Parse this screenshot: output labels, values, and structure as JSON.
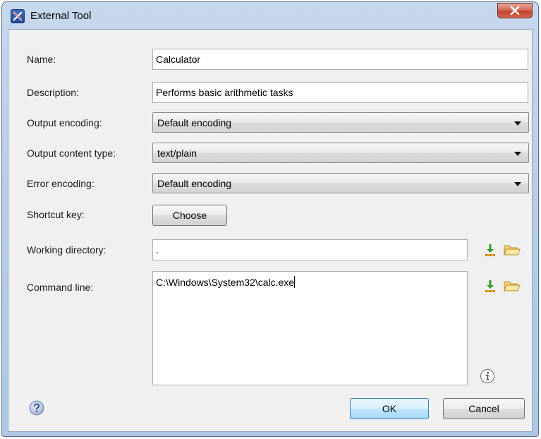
{
  "window": {
    "title": "External Tool",
    "close_label": "X"
  },
  "form": {
    "name_label": "Name:",
    "name_value": "Calculator",
    "description_label": "Description:",
    "description_value": "Performs basic arithmetic tasks",
    "output_encoding_label": "Output encoding:",
    "output_encoding_value": "Default encoding",
    "output_content_type_label": "Output content type:",
    "output_content_type_value": "text/plain",
    "error_encoding_label": "Error encoding:",
    "error_encoding_value": "Default encoding",
    "shortcut_key_label": "Shortcut key:",
    "shortcut_choose_label": "Choose",
    "working_directory_label": "Working directory:",
    "working_directory_value": ".",
    "command_line_label": "Command line:",
    "command_line_value": "C:\\Windows\\System32\\calc.exe"
  },
  "icons": {
    "insert_editor_variable": "insert-variable-icon",
    "browse_folder": "folder-icon",
    "info": "info-icon",
    "help": "help-icon"
  },
  "footer": {
    "ok_label": "OK",
    "cancel_label": "Cancel"
  },
  "colors": {
    "title_bar": "#b9cde6",
    "close_button": "#c2432d",
    "dialog_background": "#f0f0f0",
    "default_button": "#bee6fd"
  }
}
